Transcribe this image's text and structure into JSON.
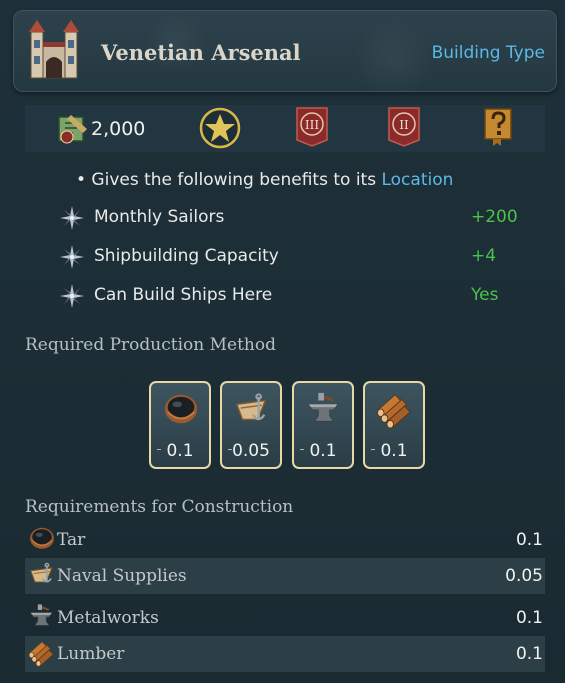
{
  "header": {
    "title": "Venetian Arsenal",
    "type_link": "Building Type",
    "icon": "arsenal-gate-icon"
  },
  "statbar": {
    "cost": "2,000",
    "cost_icon": "construction-cost-icon",
    "icons": [
      "star-icon",
      "rank-3-icon",
      "rank-2-icon",
      "book-question-icon"
    ],
    "rank3_numeral": "III",
    "rank2_numeral": "II"
  },
  "benefits": {
    "intro": "• Gives the following benefits to its ",
    "intro_link": "Location",
    "items": [
      {
        "label": "Monthly Sailors",
        "value": "+200"
      },
      {
        "label": "Shipbuilding Capacity",
        "value": "+4"
      },
      {
        "label": "Can Build Ships Here",
        "value": "Yes"
      }
    ],
    "value_color": "#4cc24c"
  },
  "production": {
    "title": "Required Production Method",
    "cards": [
      {
        "icon": "tar-bowl-icon",
        "value": "0.1"
      },
      {
        "icon": "naval-supplies-icon",
        "value": "0.05"
      },
      {
        "icon": "metalworks-anvil-icon",
        "value": "0.1"
      },
      {
        "icon": "lumber-logs-icon",
        "value": "0.1"
      }
    ]
  },
  "construction": {
    "title": "Requirements for Construction",
    "rows": [
      {
        "label": "Tar",
        "value": "0.1"
      },
      {
        "label": "Naval Supplies",
        "value": "0.05"
      },
      {
        "label": "Metalworks",
        "value": "0.1"
      },
      {
        "label": "Lumber",
        "value": "0.1"
      }
    ]
  },
  "colors": {
    "link": "#5cb8e6",
    "card_border": "#e8d8a6",
    "background": "#1c2c33"
  }
}
